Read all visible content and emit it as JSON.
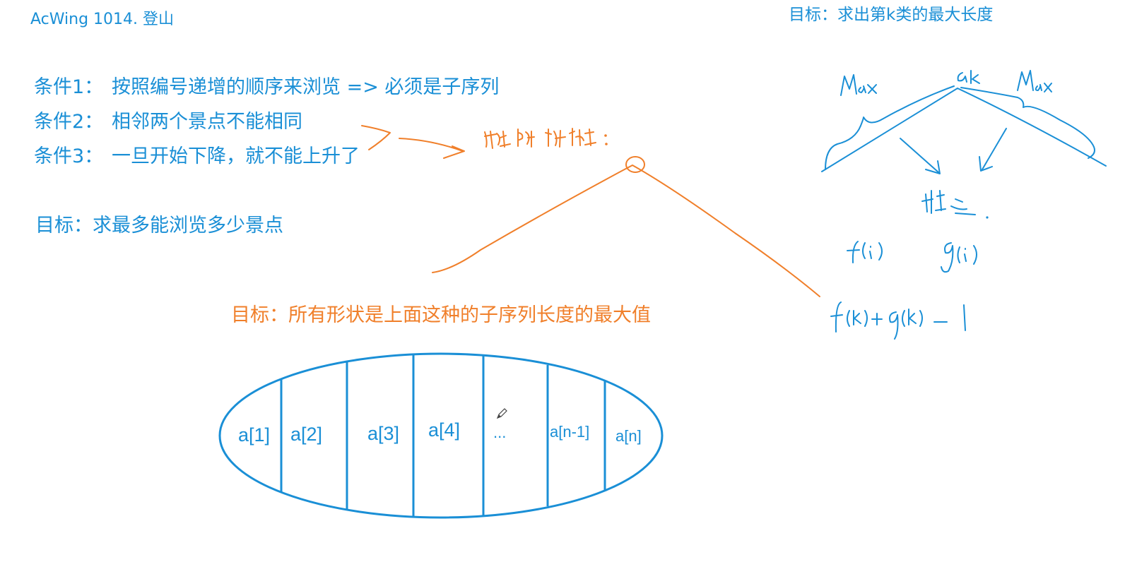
{
  "title": "AcWing 1014. 登山",
  "goal_k": "目标：求出第k类的最大长度",
  "conditions": [
    {
      "label": "条件1：",
      "text": "按照编号递增的顺序来浏览   =>   必须是子序列"
    },
    {
      "label": "条件2：",
      "text": "相邻两个景点不能相同"
    },
    {
      "label": "条件3：",
      "text": "一旦开始下降，就不能上升了"
    }
  ],
  "goal_main": "目标：求最多能浏览多少景点",
  "goal_shape": "目标：所有形状是上面这种的子序列长度的最大值",
  "array_cells": [
    "a[1]",
    "a[2]",
    "a[3]",
    "a[4]",
    "...",
    "a[n-1]",
    "a[n]"
  ],
  "colors": {
    "blue": "#1a8fd6",
    "orange": "#f07f2a"
  },
  "icons": [
    "pencil-cursor-icon"
  ]
}
